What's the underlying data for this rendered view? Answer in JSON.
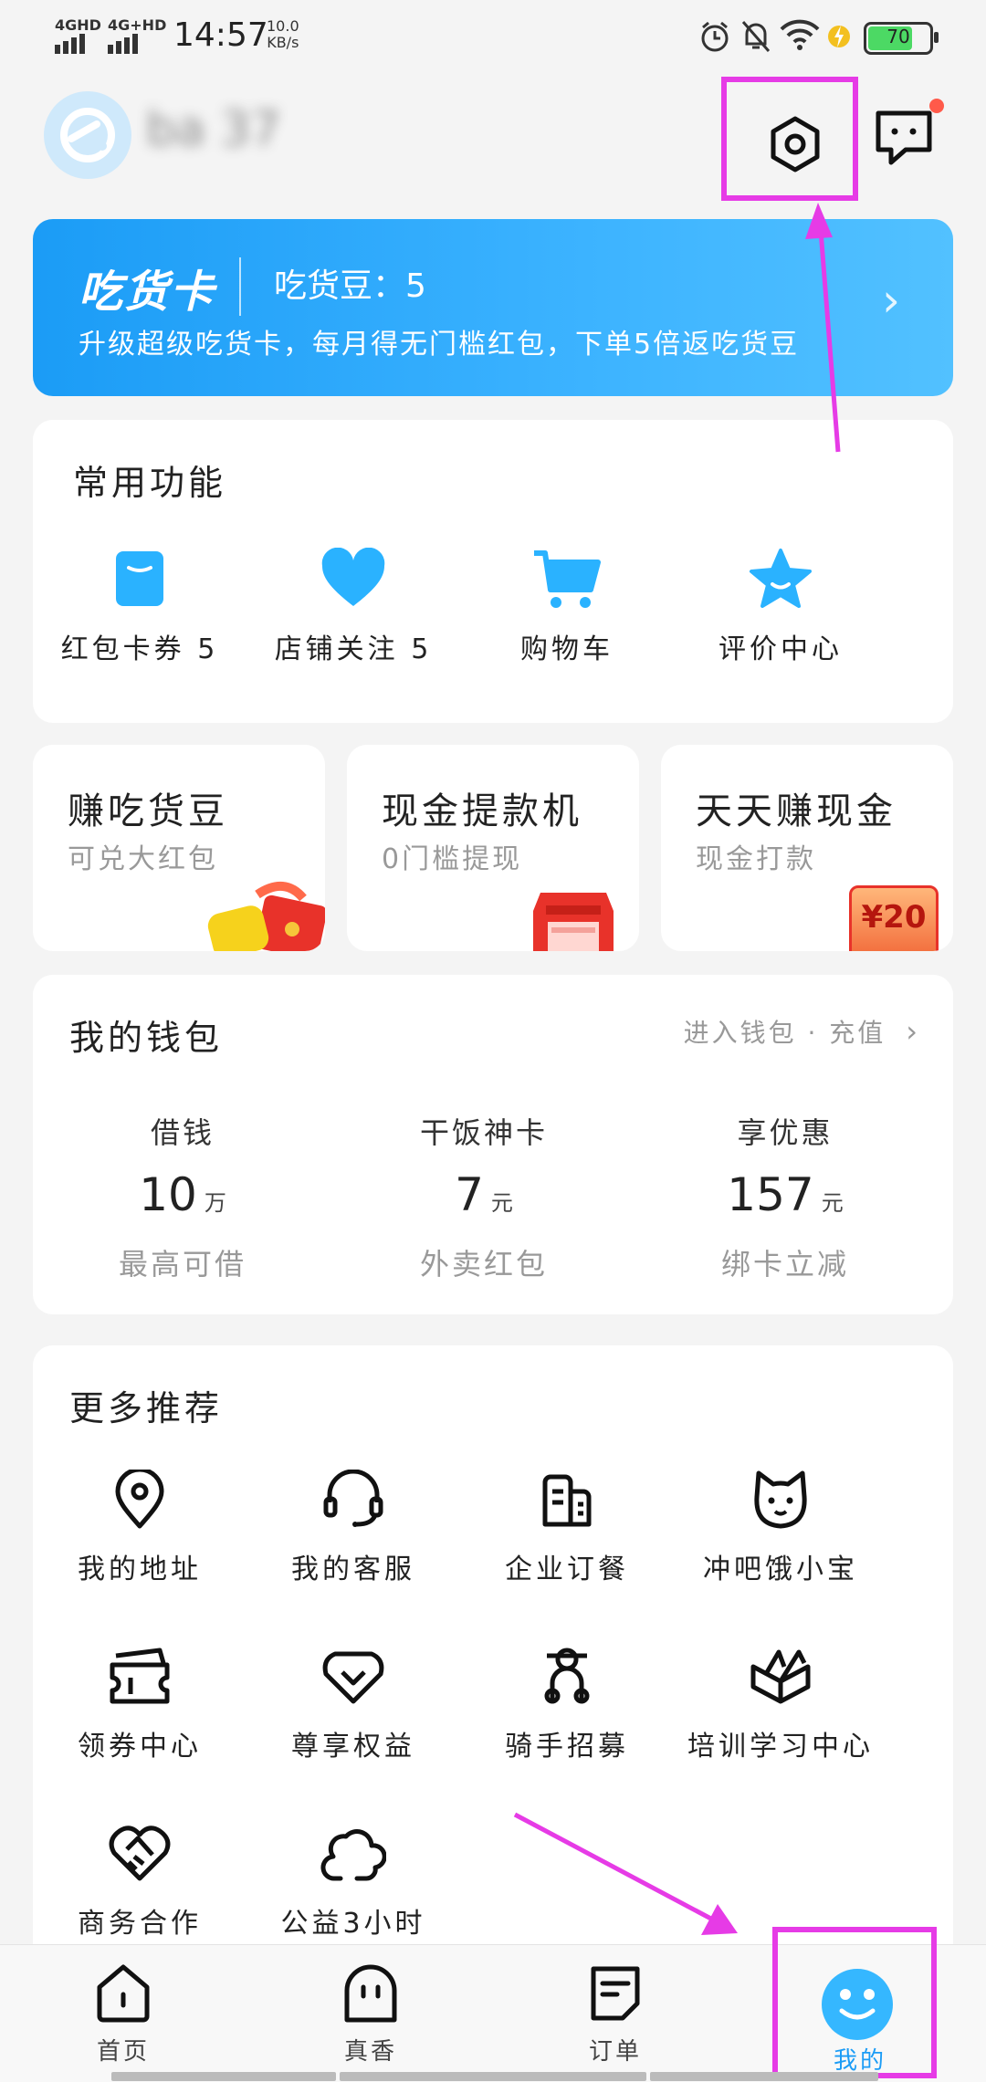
{
  "status": {
    "net1": "4GHD",
    "net2": "4G+HD",
    "time": "14:57",
    "speed_value": "10.0",
    "speed_unit": "KB/s",
    "battery": "70"
  },
  "header": {
    "username": "ba 37",
    "settings_icon": "settings-icon",
    "message_icon": "message-icon"
  },
  "chihuo_card": {
    "title": "吃货卡",
    "beans": "吃货豆：5",
    "subtitle": "升级超级吃货卡，每月得无门槛红包，下单5倍返吃货豆"
  },
  "common": {
    "title": "常用功能",
    "items": [
      {
        "label": "红包卡券 5",
        "icon": "coupon-icon"
      },
      {
        "label": "店铺关注 5",
        "icon": "heart-icon"
      },
      {
        "label": "购物车",
        "icon": "cart-icon"
      },
      {
        "label": "评价中心",
        "icon": "star-icon"
      }
    ]
  },
  "promos": [
    {
      "title": "赚吃货豆",
      "sub": "可兑大红包"
    },
    {
      "title": "现金提款机",
      "sub": "0门槛提现"
    },
    {
      "title": "天天赚现金",
      "sub": "现金打款",
      "badge": "¥20"
    }
  ],
  "wallet": {
    "title": "我的钱包",
    "link": "进入钱包 · 充值",
    "cols": [
      {
        "label": "借钱",
        "value": "10",
        "unit": "万",
        "sub": "最高可借"
      },
      {
        "label": "干饭神卡",
        "value": "7",
        "unit": "元",
        "sub": "外卖红包"
      },
      {
        "label": "享优惠",
        "value": "157",
        "unit": "元",
        "sub": "绑卡立减"
      }
    ]
  },
  "more": {
    "title": "更多推荐",
    "items": [
      {
        "label": "我的地址",
        "icon": "location-icon"
      },
      {
        "label": "我的客服",
        "icon": "headset-icon"
      },
      {
        "label": "企业订餐",
        "icon": "building-icon"
      },
      {
        "label": "冲吧饿小宝",
        "icon": "cat-face-icon"
      },
      {
        "label": "领券中心",
        "icon": "ticket-icon"
      },
      {
        "label": "尊享权益",
        "icon": "vip-heart-icon"
      },
      {
        "label": "骑手招募",
        "icon": "rider-icon"
      },
      {
        "label": "培训学习中心",
        "icon": "book-icon"
      },
      {
        "label": "商务合作",
        "icon": "handshake-icon"
      },
      {
        "label": "公益3小时",
        "icon": "cloud-icon"
      }
    ]
  },
  "nav": [
    {
      "label": "首页",
      "icon": "home-icon"
    },
    {
      "label": "真香",
      "icon": "ghost-icon"
    },
    {
      "label": "订单",
      "icon": "order-icon"
    },
    {
      "label": "我的",
      "icon": "profile-icon",
      "active": true
    }
  ],
  "colors": {
    "accent": "#1b9cf6",
    "highlight": "#e63be6",
    "badge_red": "#ff5a4a"
  }
}
